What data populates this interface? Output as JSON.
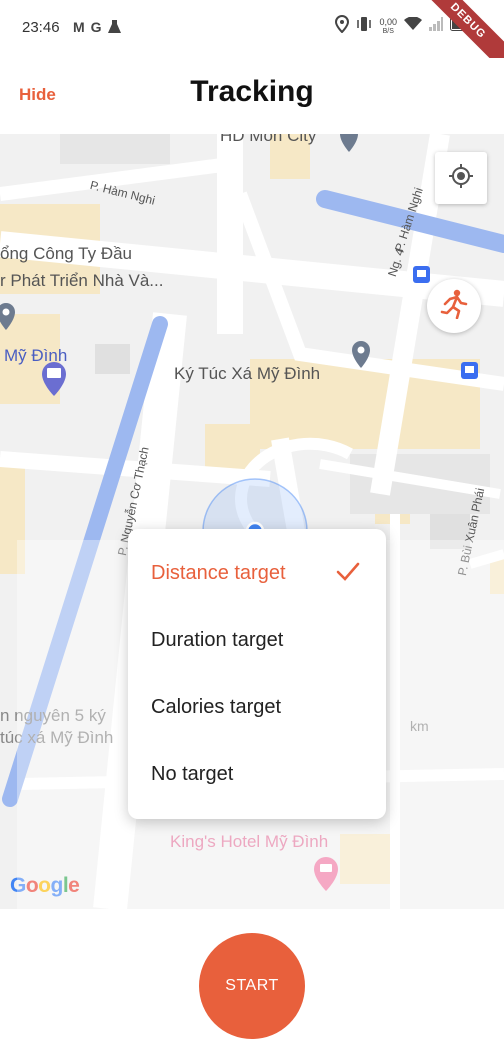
{
  "status_bar": {
    "time": "23:46",
    "left_icons": [
      "gmail-icon",
      "google-icon",
      "flask-icon"
    ],
    "net_speed_value": "0,00",
    "net_speed_unit": "B/S",
    "right_icons": [
      "location-icon",
      "vibrate-icon",
      "wifi-icon",
      "signal-icon",
      "battery-icon"
    ],
    "debug_banner": "DEBUG"
  },
  "app_bar": {
    "hide_label": "Hide",
    "title": "Tracking",
    "accent_color": "#e8603c"
  },
  "map": {
    "labels": {
      "hd_mon_city": "HD Mon City",
      "p_ham_nghi": "P. Hàm Nghi",
      "p_ham_nghi_vertical": "P. Hàm Nghi",
      "ng4": "Ng. 4",
      "cong_ty_line1": "ổng Công Ty Đầu",
      "cong_ty_line2": "r Phát Triển Nhà Và...",
      "my_dinh": "Mỹ Đình",
      "ky_tuc_xa": "Ký Túc Xá Mỹ Đình",
      "nguyen_co_thach": "P. Nguyễn Cơ Thạch",
      "bui_xuan_phai": "P. Bùi Xuân Phái",
      "nguyen_line1": "n nguyên 5 ký",
      "nguyen_line2": "túc xá Mỹ Đình",
      "kings_hotel": "King's Hotel Mỹ Đình",
      "km": "km"
    },
    "google_logo": [
      "G",
      "o",
      "o",
      "g",
      "l",
      "e"
    ],
    "locate_button_icon": "my-location-icon",
    "activity_button_icon": "running-person-icon"
  },
  "target_menu": {
    "items": [
      {
        "label": "Distance target",
        "selected": true
      },
      {
        "label": "Duration target",
        "selected": false
      },
      {
        "label": "Calories target",
        "selected": false
      },
      {
        "label": "No target",
        "selected": false
      }
    ],
    "check_icon": "check-icon"
  },
  "bottom": {
    "start_label": "START"
  }
}
